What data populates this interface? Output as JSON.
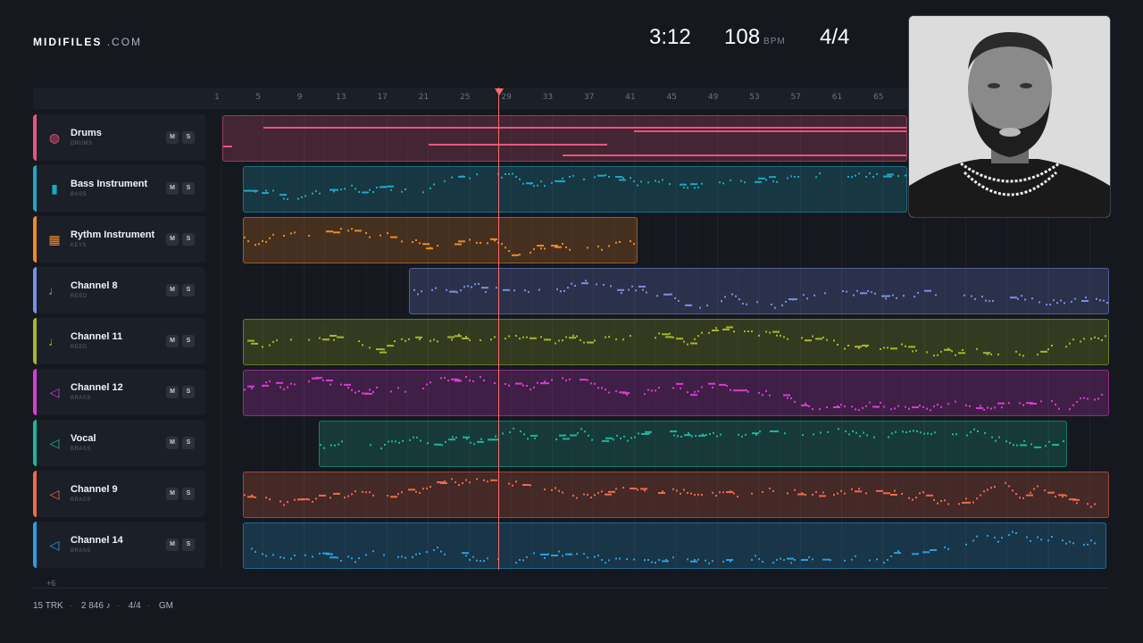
{
  "brand": {
    "name": "MIDIFILES",
    "domain": ".COM"
  },
  "header": {
    "time": "3:12",
    "tempo": "108",
    "tempo_unit": "BPM",
    "signature": "4/4"
  },
  "ruler": {
    "ticks": [
      "1",
      "5",
      "9",
      "13",
      "17",
      "21",
      "25",
      "29",
      "33",
      "37",
      "41",
      "45",
      "49",
      "53",
      "57",
      "61",
      "65"
    ]
  },
  "tracks": [
    {
      "name": "Drums",
      "sub": "DRUMS",
      "icon": "drum-icon",
      "color": "#e8557f",
      "mute": "M",
      "solo": "S"
    },
    {
      "name": "Bass Instrument",
      "sub": "BASS",
      "icon": "bass-icon",
      "color": "#1fa7c4",
      "mute": "M",
      "solo": "S"
    },
    {
      "name": "Rythm Instrument",
      "sub": "KEYS",
      "icon": "keys-icon",
      "color": "#f08a24",
      "mute": "M",
      "solo": "S"
    },
    {
      "name": "Channel 8",
      "sub": "REED",
      "icon": "reed-icon",
      "color": "#7a8fe6",
      "mute": "M",
      "solo": "S"
    },
    {
      "name": "Channel 11",
      "sub": "REED",
      "icon": "reed-icon",
      "color": "#a4b82a",
      "mute": "M",
      "solo": "S"
    },
    {
      "name": "Channel 12",
      "sub": "BRASS",
      "icon": "horn-icon",
      "color": "#d93cd4",
      "mute": "M",
      "solo": "S"
    },
    {
      "name": "Vocal",
      "sub": "BRASS",
      "icon": "horn-icon",
      "color": "#1fb59c",
      "mute": "M",
      "solo": "S"
    },
    {
      "name": "Channel 9",
      "sub": "BRASS",
      "icon": "horn-icon",
      "color": "#ef6a4a",
      "mute": "M",
      "solo": "S"
    },
    {
      "name": "Channel 14",
      "sub": "BRASS",
      "icon": "horn-icon",
      "color": "#2a9fe0",
      "mute": "M",
      "solo": "S"
    }
  ],
  "more_tracks": "+6",
  "footer": {
    "tracks": "15 TRK",
    "notes": "2 846 ♪",
    "signature": "4/4",
    "format": "GM"
  }
}
